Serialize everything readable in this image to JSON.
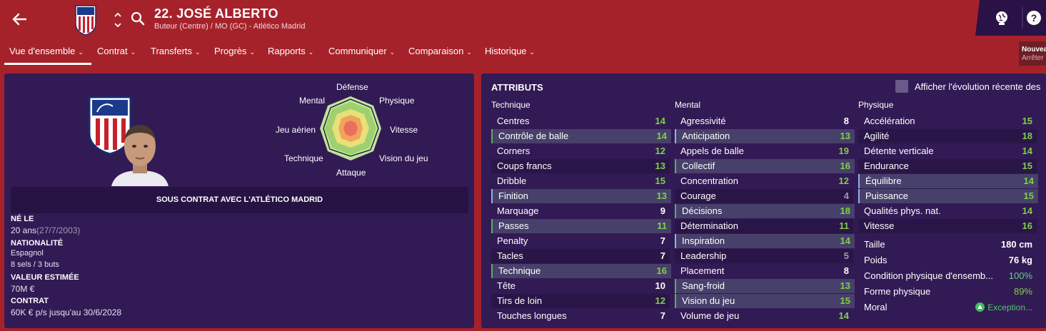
{
  "header": {
    "player_name": "22. JOSÉ ALBERTO",
    "player_sub": "Buteur (Centre) / MO (GC) - Atlético Madrid"
  },
  "nav": {
    "tabs": [
      {
        "label": "Vue d'ensemble"
      },
      {
        "label": "Contrat"
      },
      {
        "label": "Transferts"
      },
      {
        "label": "Progrès"
      },
      {
        "label": "Rapports"
      },
      {
        "label": "Communiquer"
      },
      {
        "label": "Comparaison"
      },
      {
        "label": "Historique"
      }
    ],
    "chevron": "⌄"
  },
  "notice": {
    "line1": "Nouveau",
    "line2": "Arrêter"
  },
  "profile": {
    "contract_banner": "SOUS CONTRAT AVEC L'ATLÉTICO MADRID",
    "born_label": "NÉ LE",
    "age": "20 ans",
    "dob": "(27/7/2003)",
    "nationality_label": "NATIONALITÉ",
    "nationality": "Espagnol",
    "caps": "8 sels / 3 buts",
    "value_label": "VALEUR ESTIMÉE",
    "value": "70M €",
    "contract_label": "CONTRAT",
    "contract": "60K € p/s jusqu'au 30/6/2028"
  },
  "radar": {
    "labels": {
      "defense": "Défense",
      "physique": "Physique",
      "vitesse": "Vitesse",
      "vision": "Vision du jeu",
      "attaque": "Attaque",
      "technique": "Technique",
      "jeu_aerien": "Jeu aérien",
      "mental": "Mental"
    }
  },
  "attributes": {
    "title": "ATTRIBUTS",
    "show_evolution_label": "Afficher l'évolution récente des",
    "technique_header": "Technique",
    "mental_header": "Mental",
    "physique_header": "Physique",
    "technique": [
      {
        "name": "Centres",
        "value": "14"
      },
      {
        "name": "Contrôle de balle",
        "value": "14"
      },
      {
        "name": "Corners",
        "value": "12"
      },
      {
        "name": "Coups francs",
        "value": "13"
      },
      {
        "name": "Dribble",
        "value": "15"
      },
      {
        "name": "Finition",
        "value": "13"
      },
      {
        "name": "Marquage",
        "value": "9"
      },
      {
        "name": "Passes",
        "value": "11"
      },
      {
        "name": "Penalty",
        "value": "7"
      },
      {
        "name": "Tacles",
        "value": "7"
      },
      {
        "name": "Technique",
        "value": "16"
      },
      {
        "name": "Tête",
        "value": "10"
      },
      {
        "name": "Tirs de loin",
        "value": "12"
      },
      {
        "name": "Touches longues",
        "value": "7"
      }
    ],
    "mental": [
      {
        "name": "Agressivité",
        "value": "8"
      },
      {
        "name": "Anticipation",
        "value": "13"
      },
      {
        "name": "Appels de balle",
        "value": "19"
      },
      {
        "name": "Collectif",
        "value": "16"
      },
      {
        "name": "Concentration",
        "value": "12"
      },
      {
        "name": "Courage",
        "value": "4"
      },
      {
        "name": "Décisions",
        "value": "18"
      },
      {
        "name": "Détermination",
        "value": "11"
      },
      {
        "name": "Inspiration",
        "value": "14"
      },
      {
        "name": "Leadership",
        "value": "5"
      },
      {
        "name": "Placement",
        "value": "8"
      },
      {
        "name": "Sang-froid",
        "value": "13"
      },
      {
        "name": "Vision du jeu",
        "value": "15"
      },
      {
        "name": "Volume de jeu",
        "value": "14"
      }
    ],
    "physique": [
      {
        "name": "Accélération",
        "value": "15"
      },
      {
        "name": "Agilité",
        "value": "18"
      },
      {
        "name": "Détente verticale",
        "value": "14"
      },
      {
        "name": "Endurance",
        "value": "15"
      },
      {
        "name": "Équilibre",
        "value": "14"
      },
      {
        "name": "Puissance",
        "value": "15"
      },
      {
        "name": "Qualités phys. nat.",
        "value": "14"
      },
      {
        "name": "Vitesse",
        "value": "16"
      }
    ],
    "info": [
      {
        "name": "Taille",
        "value": "180 cm"
      },
      {
        "name": "Poids",
        "value": "76 kg"
      },
      {
        "name": "Condition physique d'ensemb...",
        "value": "100%"
      },
      {
        "name": "Forme physique",
        "value": "89%"
      },
      {
        "name": "Moral",
        "value": "Exception..."
      }
    ]
  },
  "colors": {
    "header_bg": "#a6222b",
    "panel_bg": "#321a55",
    "value_green": "#7fd04a",
    "value_grey": "#a09aaf"
  }
}
